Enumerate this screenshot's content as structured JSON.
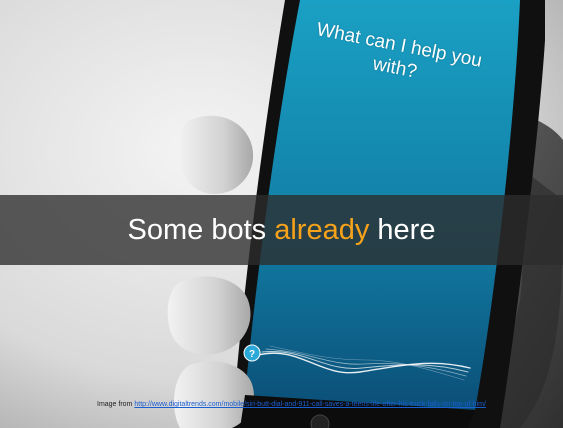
{
  "phone": {
    "prompt": "What can I help you with?",
    "help_button_glyph": "?"
  },
  "banner": {
    "text_before": "Some bots ",
    "highlight": "already",
    "text_after": " here",
    "highlight_color": "#f7a21b"
  },
  "credit": {
    "label": "Image from ",
    "url": "http://www.digitaltrends.com/mobile/siri-butt-dial-and-911-call-saves-a-teens-life-after-his-truck-falls-on-top-of-him/"
  },
  "colors": {
    "screen_top": "#1aa0c4",
    "screen_bottom": "#0b4f78",
    "banner_bg": "#2d2d2d"
  }
}
